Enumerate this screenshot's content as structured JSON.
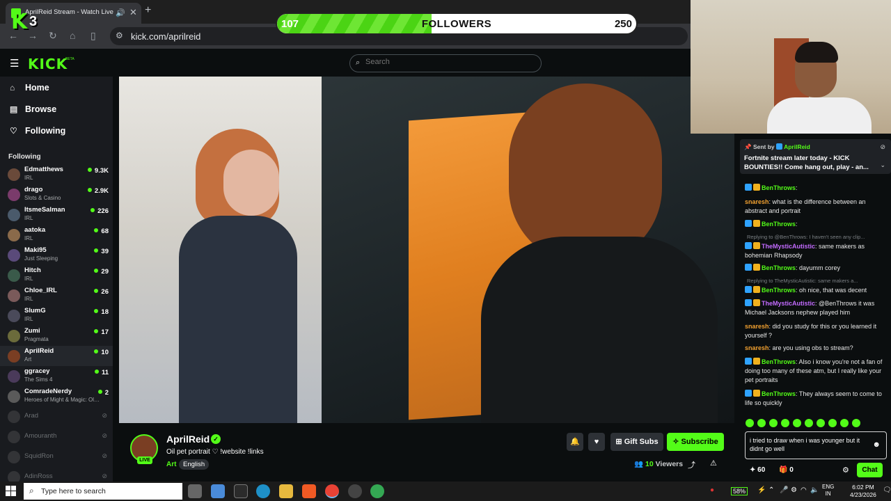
{
  "browser": {
    "tab_title": "AprilReid Stream - Watch Live on Kick",
    "url": "kick.com/aprilreid"
  },
  "overlay": {
    "badge_count": "3",
    "followers": {
      "current": "107",
      "label": "FOLLOWERS",
      "goal": "250",
      "progress": 0.43
    }
  },
  "kick": {
    "logo": "KICK",
    "beta": "BETA",
    "search_placeholder": "Search",
    "nav": [
      {
        "label": "Home",
        "icon": "home-icon"
      },
      {
        "label": "Browse",
        "icon": "browse-icon"
      },
      {
        "label": "Following",
        "icon": "heart-icon"
      }
    ],
    "following_header": "Following",
    "channels": [
      {
        "name": "Edmatthews",
        "category": "IRL",
        "viewers": "9.3K",
        "live": true
      },
      {
        "name": "drago",
        "category": "Slots & Casino",
        "viewers": "2.9K",
        "live": true
      },
      {
        "name": "ItsmeSalman",
        "category": "IRL",
        "viewers": "226",
        "live": true
      },
      {
        "name": "aatoka",
        "category": "IRL",
        "viewers": "68",
        "live": true
      },
      {
        "name": "Maki95",
        "category": "Just Sleeping",
        "viewers": "39",
        "live": true
      },
      {
        "name": "Hitch",
        "category": "IRL",
        "viewers": "29",
        "live": true
      },
      {
        "name": "Chloe_IRL",
        "category": "IRL",
        "viewers": "26",
        "live": true
      },
      {
        "name": "SlumG",
        "category": "IRL",
        "viewers": "18",
        "live": true
      },
      {
        "name": "Zumi",
        "category": "Pragmata",
        "viewers": "17",
        "live": true
      },
      {
        "name": "AprilReid",
        "category": "Art",
        "viewers": "10",
        "live": true,
        "active": true
      },
      {
        "name": "ggracey",
        "category": "The Sims 4",
        "viewers": "11",
        "live": true
      },
      {
        "name": "ComradeNerdy",
        "category": "Heroes of Might & Magic: Olden Era",
        "viewers": "2",
        "live": true
      },
      {
        "name": "Arad",
        "live": false
      },
      {
        "name": "Amouranth",
        "live": false
      },
      {
        "name": "SquidRon",
        "live": false
      },
      {
        "name": "AdinRoss",
        "live": false
      }
    ]
  },
  "stream": {
    "username": "AprilReid",
    "live_label": "LIVE",
    "title": "Oil pet portrait ♡ !website !links",
    "category": "Art",
    "language": "English",
    "gift_subs_label": "Gift Subs",
    "subscribe_label": "Subscribe",
    "viewers_count": "10",
    "viewers_label": "Viewers"
  },
  "chat": {
    "pinned": {
      "sent_by_label": "Sent by",
      "sender": "AprilReid",
      "message": "Fortnite stream later today - KICK BOUNTIES!! Come hang out, play - an..."
    },
    "messages": [
      {
        "user": "BenThrows",
        "color": "#53fc18",
        "text": "",
        "badges": [
          "mod",
          "og"
        ]
      },
      {
        "user": "snaresh",
        "color": "#f0a030",
        "text": "what is the difference between an abstract and portrait",
        "badges": []
      },
      {
        "user": "BenThrows",
        "color": "#53fc18",
        "text": "",
        "badges": [
          "mod",
          "og"
        ]
      },
      {
        "reply": "Replying to @BenThrows: I haven't seen any clip..."
      },
      {
        "user": "TheMysticAutistic",
        "color": "#c36bff",
        "text": "same makers as bohemian Rhapsody",
        "badges": [
          "mod",
          "og"
        ]
      },
      {
        "user": "BenThrows",
        "color": "#53fc18",
        "text": "dayumm corey",
        "badges": [
          "mod",
          "og"
        ]
      },
      {
        "reply": "Replying to TheMysticAutistic: same makers a..."
      },
      {
        "user": "BenThrows",
        "color": "#53fc18",
        "text": "oh nice, that was decent",
        "badges": [
          "mod",
          "og"
        ]
      },
      {
        "user": "TheMysticAutistic",
        "color": "#c36bff",
        "text": "@BenThrows it was Michael Jacksons nephew played him",
        "badges": [
          "mod",
          "og"
        ]
      },
      {
        "user": "snaresh",
        "color": "#f0a030",
        "text": "did you study for this or you learned it yourself ?",
        "badges": []
      },
      {
        "user": "snaresh",
        "color": "#f0a030",
        "text": "are you using obs to stream?",
        "badges": []
      },
      {
        "user": "BenThrows",
        "color": "#53fc18",
        "text": "Also i know you're not a fan of doing too many of these atm, but I really like your pet portraits",
        "badges": [
          "mod",
          "og"
        ]
      },
      {
        "user": "BenThrows",
        "color": "#53fc18",
        "text": "They always seem to come to life so quickly",
        "badges": [
          "mod",
          "og"
        ]
      }
    ],
    "input_value": "i tried to draw when i was younger but it didnt go well",
    "points": "60",
    "gifts": "0",
    "send_label": "Chat"
  },
  "taskbar": {
    "search_placeholder": "Type here to search",
    "battery": "58%",
    "lang_top": "ENG",
    "lang_bottom": "IN",
    "time": "6:02 PM",
    "date": "4/23/2026"
  }
}
